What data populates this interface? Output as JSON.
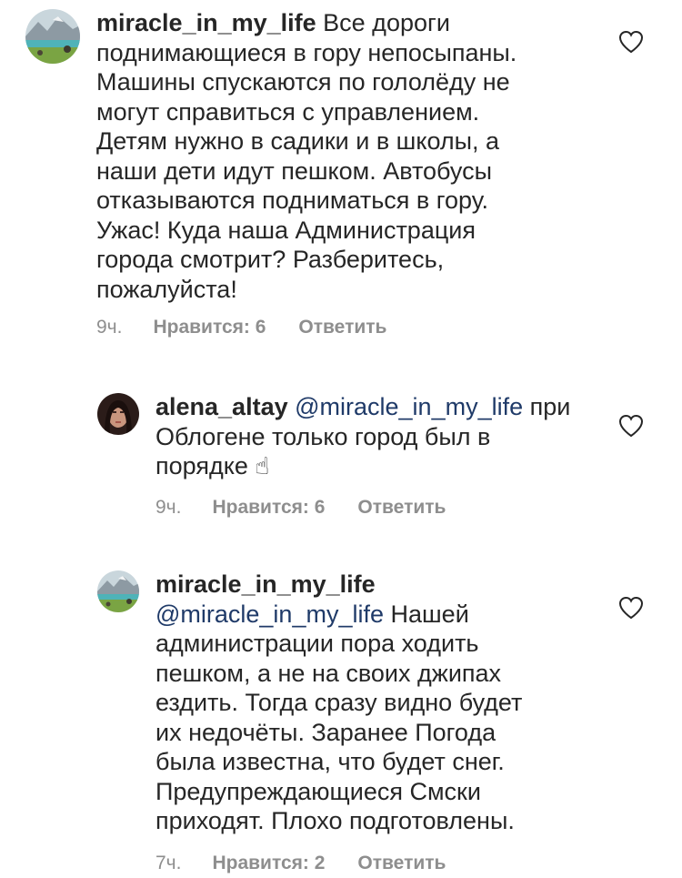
{
  "comments": [
    {
      "username": "miracle_in_my_life",
      "text_lines": [
        " Все дороги",
        "поднимающиеся в гору непосыпаны.",
        "Машины спускаются по гололёду не",
        "могут справиться с управлением.",
        "Детям нужно в садики и в школы, а",
        "наши дети идут пешком. Автобусы",
        "отказываются подниматься в гору.",
        "Ужас! Куда наша Администрация",
        "города смотрит? Разберитесь,",
        "пожалуйста!"
      ],
      "time": "9ч.",
      "likes": "Нравится: 6",
      "reply": "Ответить",
      "avatar": "landscape-avatar"
    },
    {
      "username": "alena_altay",
      "mention": "@miracle_in_my_life",
      "text_after_mention": " при",
      "text_lines": [
        "Облогене только город был в",
        "порядке"
      ],
      "emoji": "☝",
      "time": "9ч.",
      "likes": "Нравится: 6",
      "reply": "Ответить",
      "avatar": "portrait-avatar"
    },
    {
      "username": "miracle_in_my_life",
      "mention": "@miracle_in_my_life",
      "text_after_mention": " Нашей",
      "text_lines": [
        "администрации пора ходить",
        "пешком, а не на своих джипах",
        "ездить. Тогда сразу видно будет",
        "их недочёты.  Заранее Погода",
        "была известна, что будет снег.",
        "Предупреждающиеся Смски",
        "приходят. Плохо подготовлены."
      ],
      "time": "7ч.",
      "likes": "Нравится: 2",
      "reply": "Ответить",
      "avatar": "landscape-avatar"
    }
  ],
  "colors": {
    "text": "#262626",
    "meta": "#8e8e8e",
    "mention": "#1f3a68"
  },
  "icons": {
    "like": "heart-outline-icon"
  }
}
